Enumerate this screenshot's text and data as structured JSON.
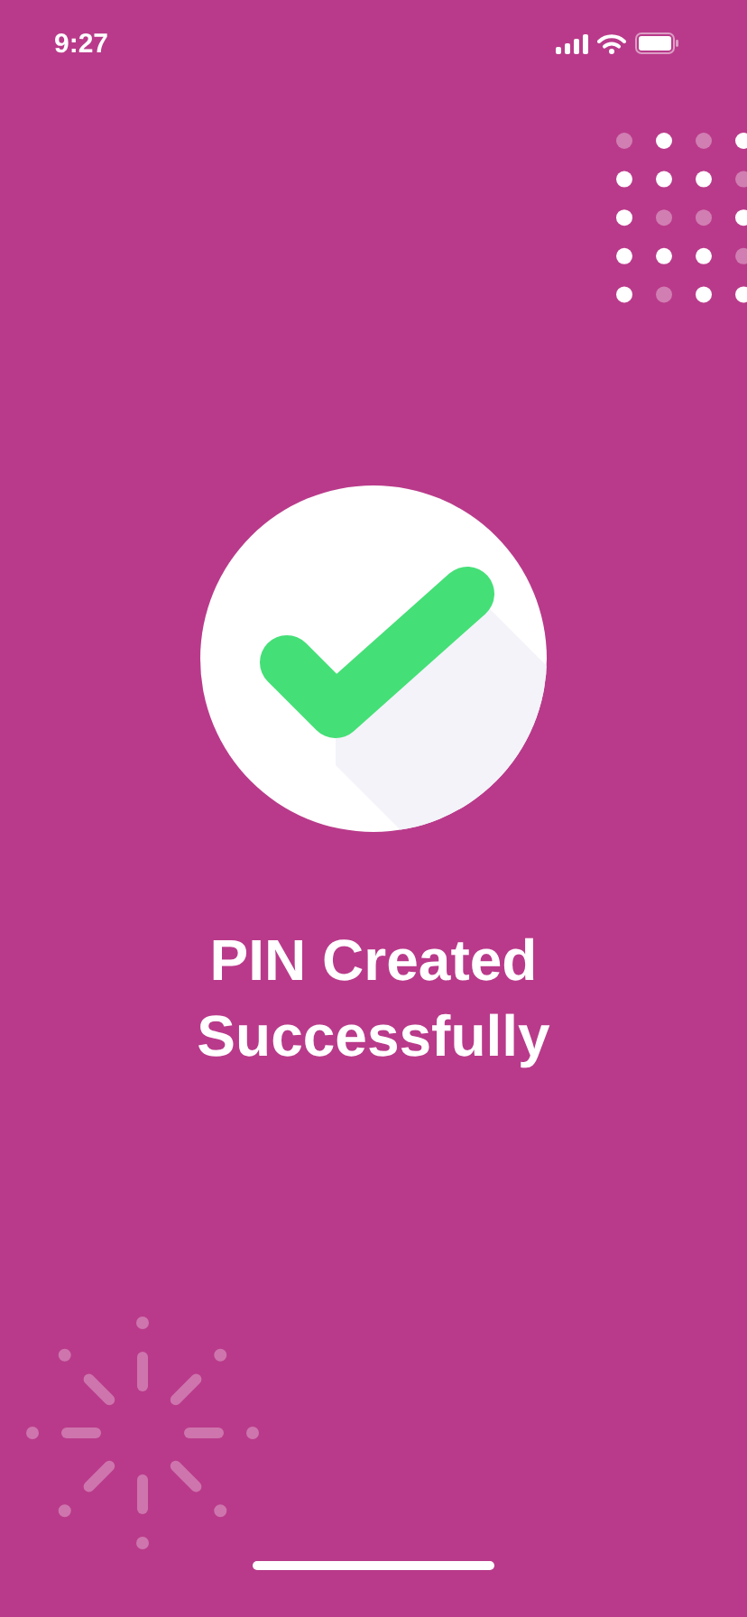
{
  "status_bar": {
    "time": "9:27"
  },
  "message": {
    "title": "PIN Created Successfully"
  }
}
